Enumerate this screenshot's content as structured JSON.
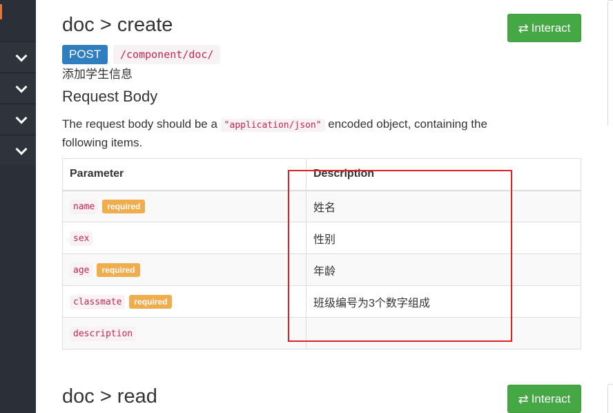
{
  "endpoints": [
    {
      "title": "doc > create",
      "interact_label": "Interact",
      "method": "POST",
      "path": "/component/doc/",
      "description": "添加学生信息",
      "request_body": {
        "heading": "Request Body",
        "intro_before": "The request body should be a ",
        "content_type": "\"application/json\"",
        "intro_after": " encoded object, containing the following items.",
        "columns": [
          "Parameter",
          "Description"
        ],
        "required_label": "required",
        "rows": [
          {
            "name": "name",
            "required": true,
            "description": "姓名"
          },
          {
            "name": "sex",
            "required": false,
            "description": "性别"
          },
          {
            "name": "age",
            "required": true,
            "description": "年龄"
          },
          {
            "name": "classmate",
            "required": true,
            "description": "班级编号为3个数字组成"
          },
          {
            "name": "description",
            "required": false,
            "description": ""
          }
        ]
      }
    },
    {
      "title": "doc > read",
      "interact_label": "Interact"
    }
  ],
  "colors": {
    "interact_button": "#45a845",
    "method_badge": "#2f7ec0",
    "required_badge": "#f0ad4e",
    "annotation_box": "#e02020",
    "sidebar": "#2b3038"
  },
  "icons": {
    "interact": "swap-arrows-icon",
    "sidebar_toggle": "chevron-down-icon"
  }
}
